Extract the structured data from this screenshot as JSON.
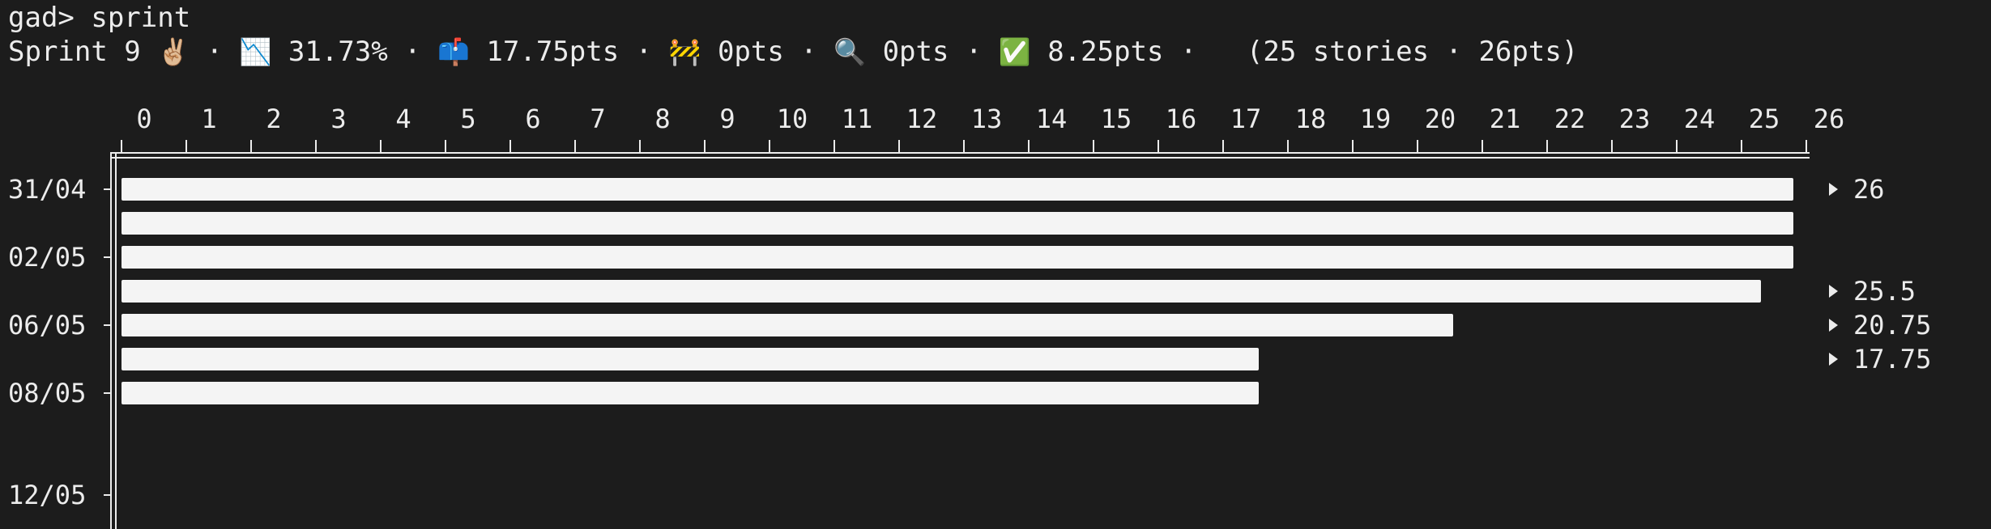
{
  "terminal": {
    "prompt": "gad> sprint"
  },
  "status": {
    "sprint_label": "Sprint 9",
    "sprint_icon": "✌🏼",
    "sep": " · ",
    "burndown_icon": "📉",
    "burndown_value": "31.73%",
    "mailbox_icon": "📫",
    "mailbox_value": "17.75pts",
    "construction_icon": "🚧",
    "construction_value": "0pts",
    "review_icon": "🔍",
    "review_value": "0pts",
    "done_icon": "✅",
    "done_value": "8.25pts",
    "summary": "(25 stories · 26pts)"
  },
  "colors": {
    "background": "#1c1c1c",
    "text": "#ececec",
    "bar": "#f4f4f4"
  },
  "chart_data": {
    "type": "bar",
    "orientation": "horizontal",
    "xlim": [
      0,
      26
    ],
    "x_ticks": [
      0,
      1,
      2,
      3,
      4,
      5,
      6,
      7,
      8,
      9,
      10,
      11,
      12,
      13,
      14,
      15,
      16,
      17,
      18,
      19,
      20,
      21,
      22,
      23,
      24,
      25,
      26
    ],
    "rows": [
      {
        "date_label": "31/04",
        "value": 26,
        "value_label": "26"
      },
      {
        "date_label": "",
        "value": 26,
        "value_label": ""
      },
      {
        "date_label": "02/05",
        "value": 26,
        "value_label": ""
      },
      {
        "date_label": "",
        "value": 25.5,
        "value_label": "25.5"
      },
      {
        "date_label": "06/05",
        "value": 20.75,
        "value_label": "20.75"
      },
      {
        "date_label": "",
        "value": 17.75,
        "value_label": "17.75"
      },
      {
        "date_label": "08/05",
        "value": 17.75,
        "value_label": ""
      },
      {
        "date_label": "",
        "value": null,
        "value_label": ""
      },
      {
        "date_label": "",
        "value": null,
        "value_label": ""
      },
      {
        "date_label": "12/05",
        "value": null,
        "value_label": ""
      },
      {
        "date_label": "",
        "value": null,
        "value_label": ""
      }
    ]
  }
}
